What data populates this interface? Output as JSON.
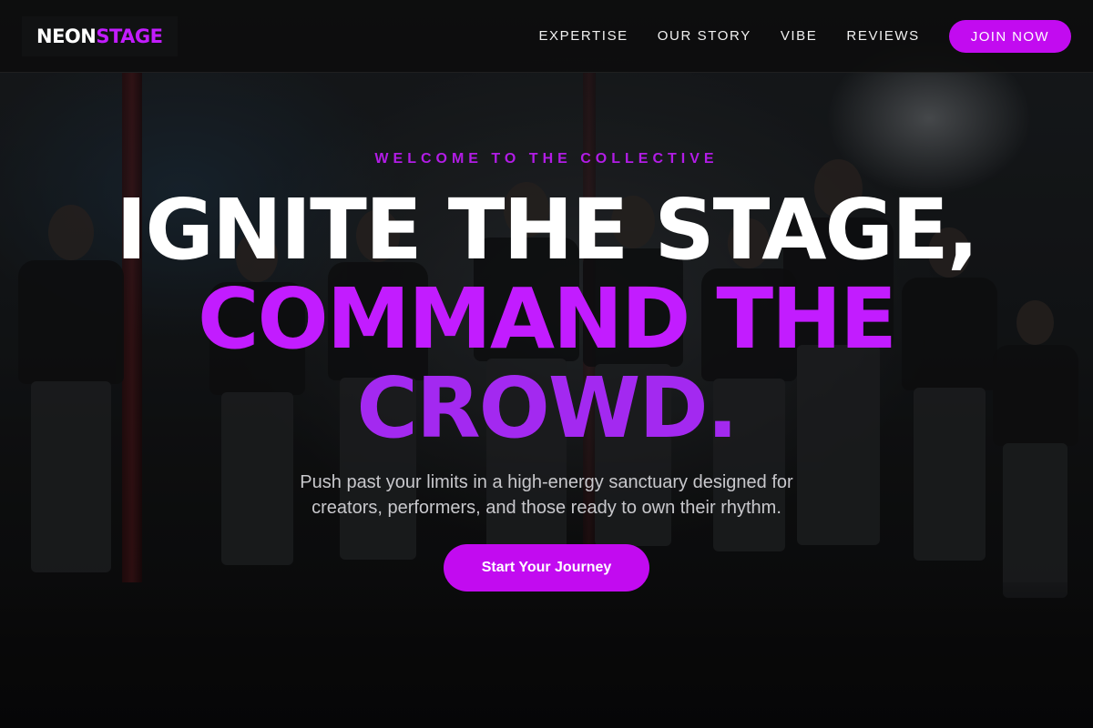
{
  "brand": {
    "part1": "NEON",
    "part2": "STAGE"
  },
  "nav": {
    "items": [
      "EXPERTISE",
      "OUR STORY",
      "VIBE",
      "REVIEWS"
    ],
    "cta_label": "JOIN NOW"
  },
  "hero": {
    "eyebrow": "WELCOME TO THE COLLECTIVE",
    "headline_line1": "IGNITE THE STAGE,",
    "headline_line2": "COMMAND THE",
    "headline_line3": "CROWD.",
    "subtitle": "Push past your limits in a high-energy sanctuary designed for creators, performers, and those ready to own their rhythm.",
    "cta_label": "Start Your Journey"
  },
  "colors": {
    "accent": "#c20bf0",
    "accent_text": "#c21cff",
    "accent_secondary": "#a329f0",
    "background": "#0c0c0d"
  }
}
